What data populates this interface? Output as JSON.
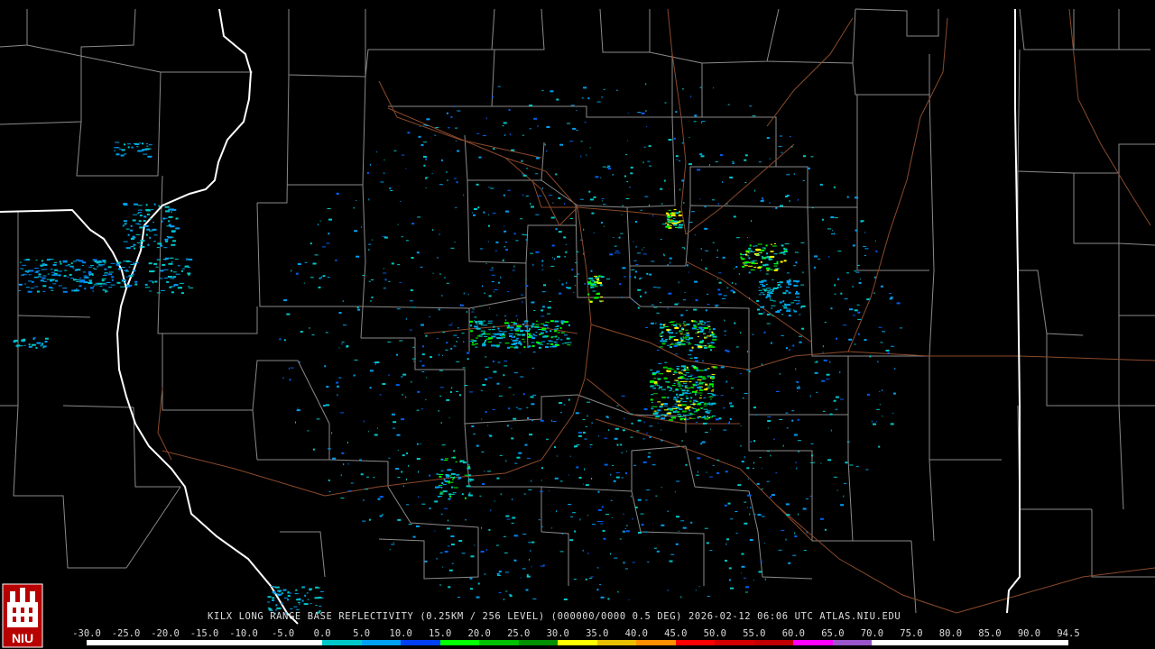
{
  "caption": "KILX LONG RANGE BASE REFLECTIVITY (0.25KM / 256 LEVEL) (000000/0000 0.5 DEG) 2026-02-12 06:06 UTC  ATLAS.NIU.EDU",
  "logo": {
    "text": "NIU",
    "icon": "niu-castle-logo"
  },
  "scale": {
    "labels": [
      "-30.0",
      "-25.0",
      "-20.0",
      "-15.0",
      "-10.0",
      "-5.0",
      "0.0",
      "5.0",
      "10.0",
      "15.0",
      "20.0",
      "25.0",
      "30.0",
      "35.0",
      "40.0",
      "45.0",
      "50.0",
      "55.0",
      "60.0",
      "65.0",
      "70.0",
      "75.0",
      "80.0",
      "85.0",
      "90.0",
      "94.5"
    ],
    "colors": [
      "#ffffff",
      "#ffffff",
      "#ffffff",
      "#ffffff",
      "#ffffff",
      "#ffffff",
      "#00c8c8",
      "#00a0f0",
      "#0040f0",
      "#00ff00",
      "#00c000",
      "#009000",
      "#ffff00",
      "#e7c000",
      "#ff9000",
      "#ff0000",
      "#d40000",
      "#c00000",
      "#ff00ff",
      "#9955c9",
      "#ffffff",
      "#ffffff",
      "#ffffff",
      "#ffffff",
      "#ffffff"
    ]
  },
  "map_colors": {
    "background": "#000000",
    "county_lines": "#8a8a8a",
    "state_lines": "#ffffff",
    "roads": "#8b4a2b"
  }
}
